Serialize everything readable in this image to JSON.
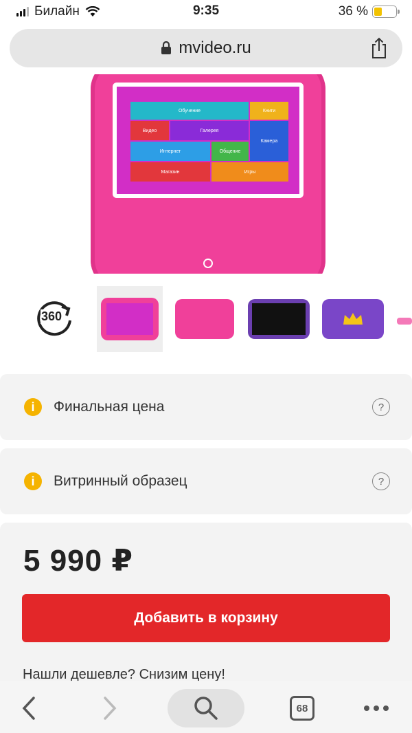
{
  "status_bar": {
    "carrier": "Билайн",
    "time": "9:35",
    "battery_percent": "36 %",
    "battery_level": 0.36
  },
  "browser": {
    "url": "mvideo.ru",
    "tab_count": "68"
  },
  "product": {
    "screen_tiles": [
      {
        "label": "Обучение",
        "color": "#24b8c9"
      },
      {
        "label": "Книги",
        "color": "#f0b21b"
      },
      {
        "label": "Видео",
        "color": "#e2373c"
      },
      {
        "label": "Галерея",
        "color": "#8a2bd8"
      },
      {
        "label": "Камера",
        "color": "#2a5fd8"
      },
      {
        "label": "Интернет",
        "color": "#2d9ee6"
      },
      {
        "label": "Общение",
        "color": "#43b649"
      },
      {
        "label": "Магазин",
        "color": "#e2373c"
      },
      {
        "label": "Игры",
        "color": "#f08c1b"
      }
    ],
    "rotate_label": "360"
  },
  "info_items": [
    {
      "label": "Финальная цена",
      "help": "?"
    },
    {
      "label": "Витринный образец",
      "help": "?"
    }
  ],
  "price": {
    "value": "5 990 ₽",
    "add_to_cart": "Добавить в корзину",
    "cheaper_text": "Нашли дешевле? Снизим цену!"
  },
  "colors": {
    "accent_red": "#e32729",
    "tablet_pink": "#f0409a",
    "info_yellow": "#f5b300"
  }
}
